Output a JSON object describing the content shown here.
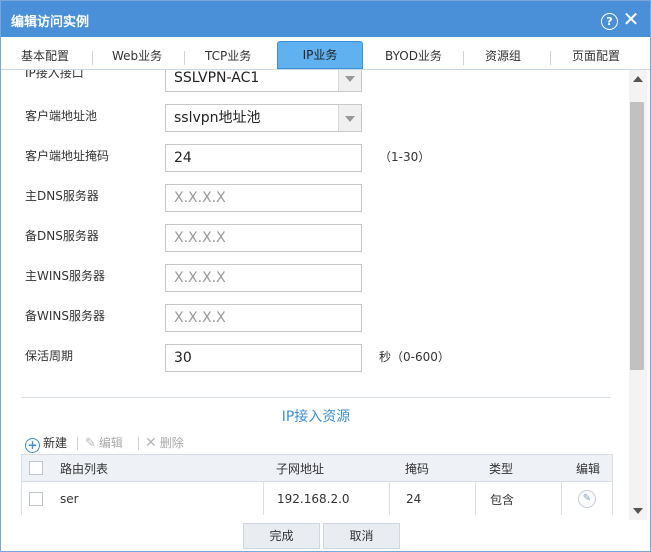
{
  "dialog": {
    "title": "编辑访问实例",
    "help_glyph": "?",
    "close_glyph": "✕"
  },
  "tabs": [
    {
      "label": "基本配置",
      "active": false
    },
    {
      "label": "Web业务",
      "active": false
    },
    {
      "label": "TCP业务",
      "active": false
    },
    {
      "label": "IP业务",
      "active": true
    },
    {
      "label": "BYOD业务",
      "active": false
    },
    {
      "label": "资源组",
      "active": false
    },
    {
      "label": "页面配置",
      "active": false
    }
  ],
  "form": {
    "ip_access_interface": {
      "label": "IP接入接口",
      "value": "SSLVPN-AC1"
    },
    "client_pool": {
      "label": "客户端地址池",
      "value": "sslvpn地址池"
    },
    "client_mask": {
      "label": "客户端地址掩码",
      "value": "24",
      "hint": "（1-30）"
    },
    "primary_dns": {
      "label": "主DNS服务器",
      "placeholder": "X.X.X.X"
    },
    "backup_dns": {
      "label": "备DNS服务器",
      "placeholder": "X.X.X.X"
    },
    "primary_wins": {
      "label": "主WINS服务器",
      "placeholder": "X.X.X.X"
    },
    "backup_wins": {
      "label": "备WINS服务器",
      "placeholder": "X.X.X.X"
    },
    "keepalive": {
      "label": "保活周期",
      "value": "30",
      "hint": "秒（0-600）"
    }
  },
  "resources": {
    "title": "IP接入资源",
    "toolbar": {
      "new_label": "新建",
      "edit_label": "编辑",
      "delete_label": "删除"
    },
    "columns": [
      "路由列表",
      "子网地址",
      "掩码",
      "类型",
      "编辑"
    ],
    "rows": [
      {
        "route_list": "ser",
        "subnet": "192.168.2.0",
        "mask": "24",
        "type": "包含"
      }
    ]
  },
  "footer": {
    "ok_label": "完成",
    "cancel_label": "取消"
  },
  "colors": {
    "accent": "#4a90d9",
    "active_tab": "#5fb1f0",
    "section_title": "#3d8fd6"
  }
}
